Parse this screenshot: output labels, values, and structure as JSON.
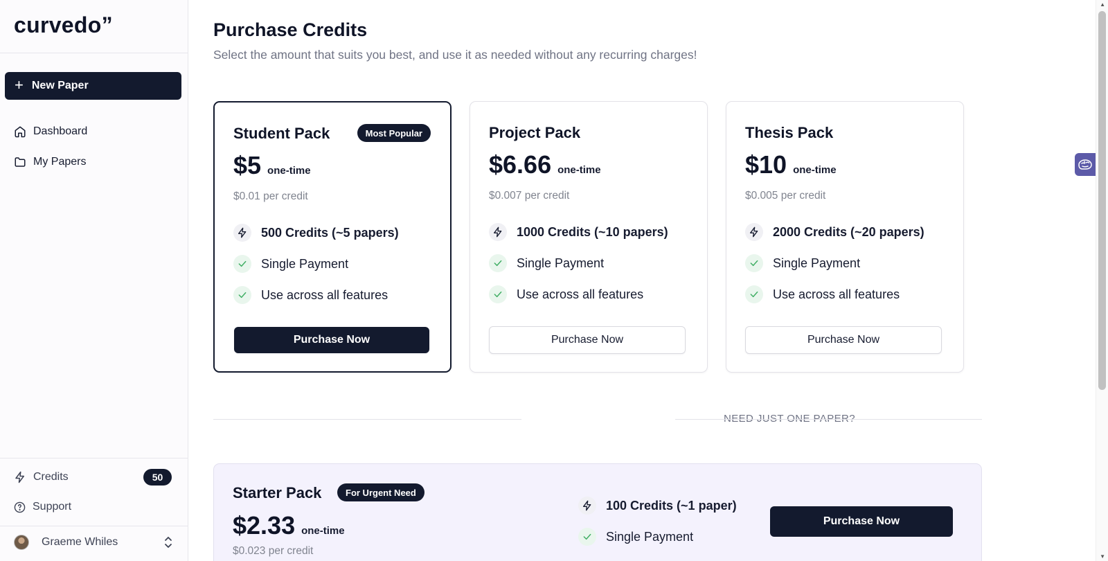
{
  "sidebar": {
    "logo": "curvedo”",
    "new_paper_label": "New Paper",
    "nav": {
      "dashboard": "Dashboard",
      "my_papers": "My Papers"
    },
    "credits_label": "Credits",
    "credits_count": "50",
    "support_label": "Support",
    "user_name": "Graeme Whiles"
  },
  "main": {
    "title": "Purchase Credits",
    "subtitle": "Select the amount that suits you best, and use it as needed without any recurring charges!",
    "plans": [
      {
        "name": "Student Pack",
        "badge": "Most Popular",
        "price": "$5",
        "billing": "one-time",
        "per_credit": "$0.01 per credit",
        "credits": "500 Credits (~5 papers)",
        "feature_1": "Single Payment",
        "feature_2": "Use across all features",
        "button": "Purchase Now"
      },
      {
        "name": "Project Pack",
        "price": "$6.66",
        "billing": "one-time",
        "per_credit": "$0.007 per credit",
        "credits": "1000 Credits (~10 papers)",
        "feature_1": "Single Payment",
        "feature_2": "Use across all features",
        "button": "Purchase Now"
      },
      {
        "name": "Thesis Pack",
        "price": "$10",
        "billing": "one-time",
        "per_credit": "$0.005 per credit",
        "credits": "2000 Credits (~20 papers)",
        "feature_1": "Single Payment",
        "feature_2": "Use across all features",
        "button": "Purchase Now"
      }
    ],
    "divider_text": "NEED JUST ONE PAPER?",
    "starter": {
      "name": "Starter Pack",
      "badge": "For Urgent Need",
      "price": "$2.33",
      "billing": "one-time",
      "per_credit": "$0.023 per credit",
      "credits": "100 Credits (~1 paper)",
      "feature_1": "Single Payment",
      "button": "Purchase Now"
    }
  },
  "colors": {
    "primary": "#131a2e",
    "check_green": "#3fae63",
    "starter_bg": "#f4f2fd",
    "widget": "#5c5aa8"
  },
  "icons": [
    "plus-icon",
    "home-icon",
    "folder-icon",
    "bolt-icon",
    "help-circle-icon",
    "check-icon",
    "chevrons-up-down-icon",
    "brain-icon"
  ]
}
